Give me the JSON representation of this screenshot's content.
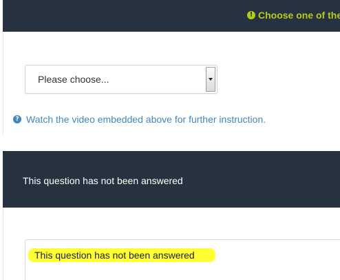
{
  "header": {
    "warning_text": "Choose one of the",
    "warning_icon": "exclamation-circle-icon",
    "warning_color": "#b5cc18",
    "background_color": "#263240"
  },
  "question": {
    "select": {
      "selected_value": "Please choose..."
    },
    "help": {
      "icon": "question-circle-icon",
      "text": "Watch the video embedded above for further instruction.",
      "color": "#3f86c7"
    }
  },
  "answer_panel": {
    "title": "This question has not been answered",
    "body_text": "This question has not been answered",
    "highlight_color": "#ffff33"
  }
}
